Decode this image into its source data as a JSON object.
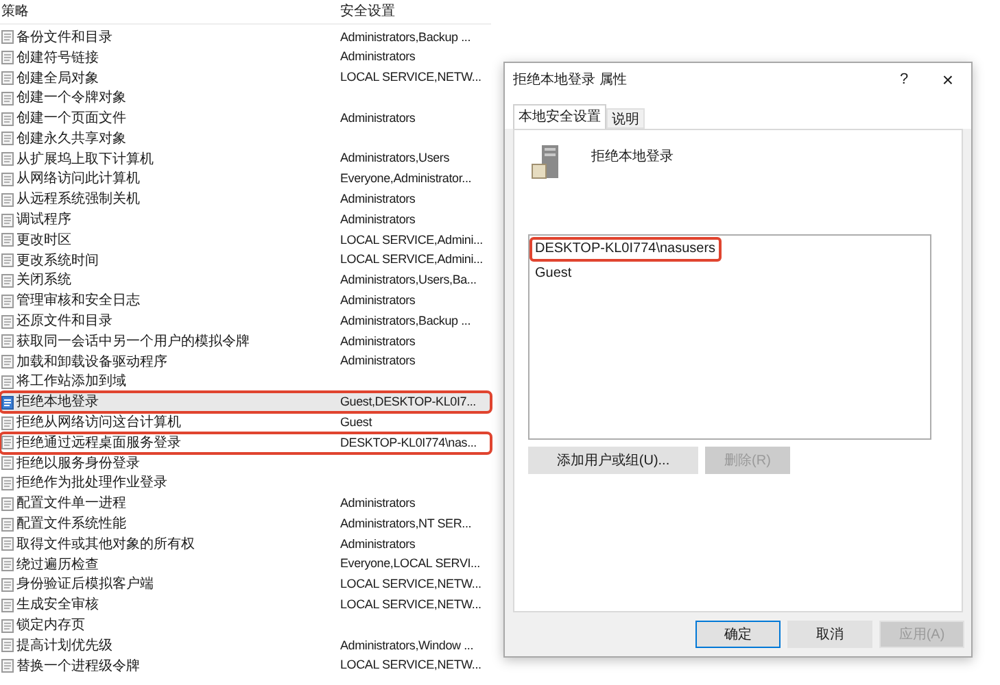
{
  "policy_table": {
    "columns": [
      "策略",
      "安全设置"
    ],
    "rows": [
      {
        "name": "备份文件和目录",
        "setting": "Administrators,Backup ...",
        "selected": false,
        "highlighted": false
      },
      {
        "name": "创建符号链接",
        "setting": "Administrators",
        "selected": false,
        "highlighted": false
      },
      {
        "name": "创建全局对象",
        "setting": "LOCAL SERVICE,NETW...",
        "selected": false,
        "highlighted": false
      },
      {
        "name": "创建一个令牌对象",
        "setting": "",
        "selected": false,
        "highlighted": false
      },
      {
        "name": "创建一个页面文件",
        "setting": "Administrators",
        "selected": false,
        "highlighted": false
      },
      {
        "name": "创建永久共享对象",
        "setting": "",
        "selected": false,
        "highlighted": false
      },
      {
        "name": "从扩展坞上取下计算机",
        "setting": "Administrators,Users",
        "selected": false,
        "highlighted": false
      },
      {
        "name": "从网络访问此计算机",
        "setting": "Everyone,Administrator...",
        "selected": false,
        "highlighted": false
      },
      {
        "name": "从远程系统强制关机",
        "setting": "Administrators",
        "selected": false,
        "highlighted": false
      },
      {
        "name": "调试程序",
        "setting": "Administrators",
        "selected": false,
        "highlighted": false
      },
      {
        "name": "更改时区",
        "setting": "LOCAL SERVICE,Admini...",
        "selected": false,
        "highlighted": false
      },
      {
        "name": "更改系统时间",
        "setting": "LOCAL SERVICE,Admini...",
        "selected": false,
        "highlighted": false
      },
      {
        "name": "关闭系统",
        "setting": "Administrators,Users,Ba...",
        "selected": false,
        "highlighted": false
      },
      {
        "name": "管理审核和安全日志",
        "setting": "Administrators",
        "selected": false,
        "highlighted": false
      },
      {
        "name": "还原文件和目录",
        "setting": "Administrators,Backup ...",
        "selected": false,
        "highlighted": false
      },
      {
        "name": "获取同一会话中另一个用户的模拟令牌",
        "setting": "Administrators",
        "selected": false,
        "highlighted": false
      },
      {
        "name": "加载和卸载设备驱动程序",
        "setting": "Administrators",
        "selected": false,
        "highlighted": false
      },
      {
        "name": "将工作站添加到域",
        "setting": "",
        "selected": false,
        "highlighted": false
      },
      {
        "name": "拒绝本地登录",
        "setting": "Guest,DESKTOP-KL0I7...",
        "selected": true,
        "highlighted": true
      },
      {
        "name": "拒绝从网络访问这台计算机",
        "setting": "Guest",
        "selected": false,
        "highlighted": false
      },
      {
        "name": "拒绝通过远程桌面服务登录",
        "setting": "DESKTOP-KL0I774\\nas...",
        "selected": false,
        "highlighted": true
      },
      {
        "name": "拒绝以服务身份登录",
        "setting": "",
        "selected": false,
        "highlighted": false
      },
      {
        "name": "拒绝作为批处理作业登录",
        "setting": "",
        "selected": false,
        "highlighted": false
      },
      {
        "name": "配置文件单一进程",
        "setting": "Administrators",
        "selected": false,
        "highlighted": false
      },
      {
        "name": "配置文件系统性能",
        "setting": "Administrators,NT SER...",
        "selected": false,
        "highlighted": false
      },
      {
        "name": "取得文件或其他对象的所有权",
        "setting": "Administrators",
        "selected": false,
        "highlighted": false
      },
      {
        "name": "绕过遍历检查",
        "setting": "Everyone,LOCAL SERVI...",
        "selected": false,
        "highlighted": false
      },
      {
        "name": "身份验证后模拟客户端",
        "setting": "LOCAL SERVICE,NETW...",
        "selected": false,
        "highlighted": false
      },
      {
        "name": "生成安全审核",
        "setting": "LOCAL SERVICE,NETW...",
        "selected": false,
        "highlighted": false
      },
      {
        "name": "锁定内存页",
        "setting": "",
        "selected": false,
        "highlighted": false
      },
      {
        "name": "提高计划优先级",
        "setting": "Administrators,Window ...",
        "selected": false,
        "highlighted": false
      },
      {
        "name": "替换一个进程级令牌",
        "setting": "LOCAL SERVICE,NETW...",
        "selected": false,
        "highlighted": false
      }
    ]
  },
  "dialog": {
    "title": "拒绝本地登录 属性",
    "help": "?",
    "close": "×",
    "tabs": [
      {
        "label": "本地安全设置",
        "selected": true
      },
      {
        "label": "说明",
        "selected": false
      }
    ],
    "policy_name": "拒绝本地登录",
    "members": [
      {
        "name": "DESKTOP-KL0I774\\nasusers",
        "highlighted": true
      },
      {
        "name": "Guest",
        "highlighted": false
      }
    ],
    "list_buttons": [
      {
        "label": "添加用户或组(U)...",
        "disabled": false
      },
      {
        "label": "删除(R)",
        "disabled": true
      }
    ],
    "footer_buttons": [
      {
        "label": "确定",
        "disabled": false,
        "default": true
      },
      {
        "label": "取消",
        "disabled": false,
        "default": false
      },
      {
        "label": "应用(A)",
        "disabled": true,
        "default": false
      }
    ]
  }
}
